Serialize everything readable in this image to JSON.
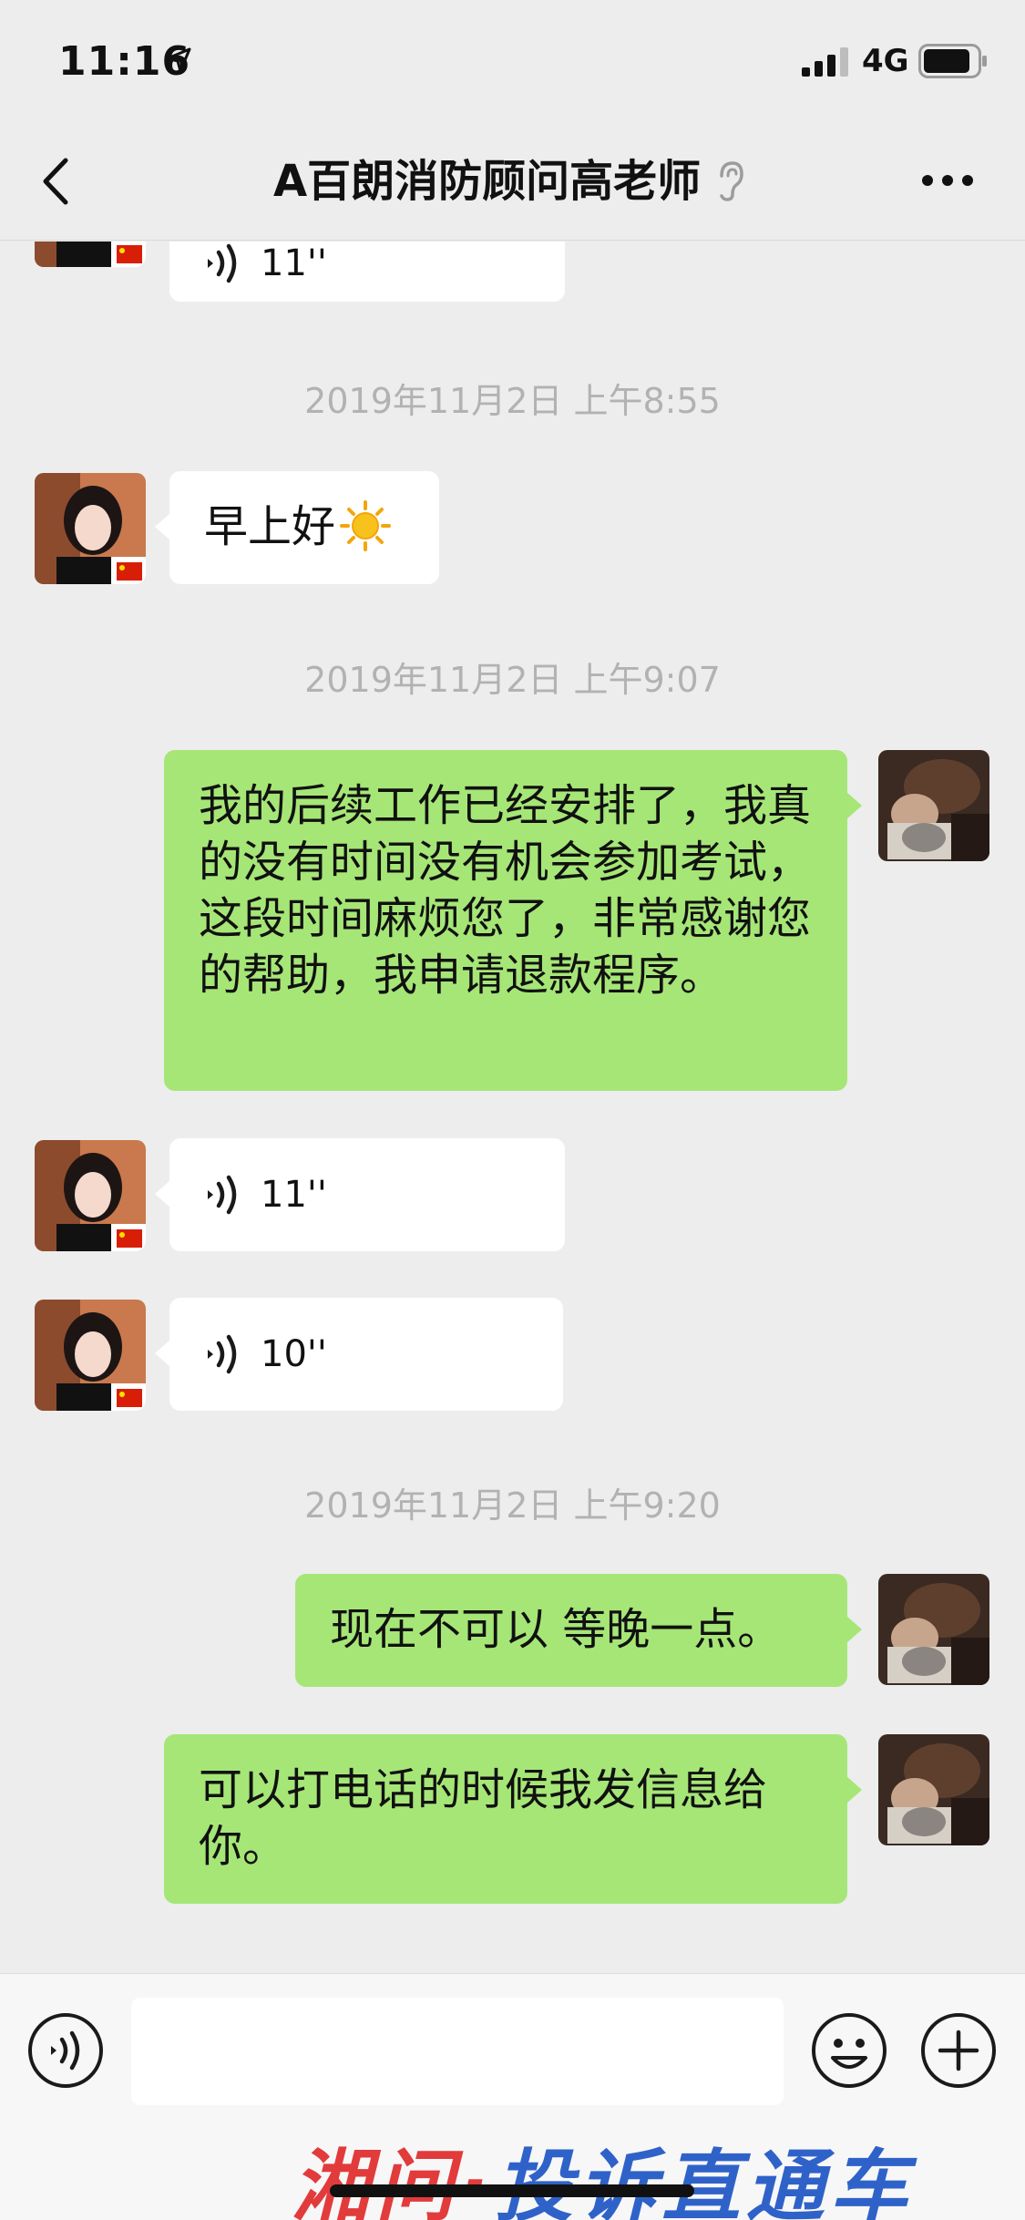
{
  "status_bar": {
    "time": "11:16",
    "network": "4G"
  },
  "nav": {
    "title": "A百朗消防顾问高老师"
  },
  "messages": {
    "voice_partial_duration": "11''",
    "ts1": "2019年11月2日 上午8:55",
    "greeting": "早上好",
    "ts2": "2019年11月2日 上午9:07",
    "refund_request": "我的后续工作已经安排了，我真的没有时间没有机会参加考试，这段时间麻烦您了，非常感谢您的帮助，我申请退款程序。",
    "voice1_duration": "11''",
    "voice2_duration": "10''",
    "ts3": "2019年11月2日 上午9:20",
    "not_now": "现在不可以 等晚一点。",
    "call_later": "可以打电话的时候我发信息给你。"
  },
  "watermark": {
    "part1": "湘问·",
    "part2": "投诉直通车"
  },
  "colors": {
    "background": "#ededed",
    "bubble_out": "#a6e677",
    "bubble_in": "#ffffff",
    "timestamp": "#b2b2b2"
  }
}
